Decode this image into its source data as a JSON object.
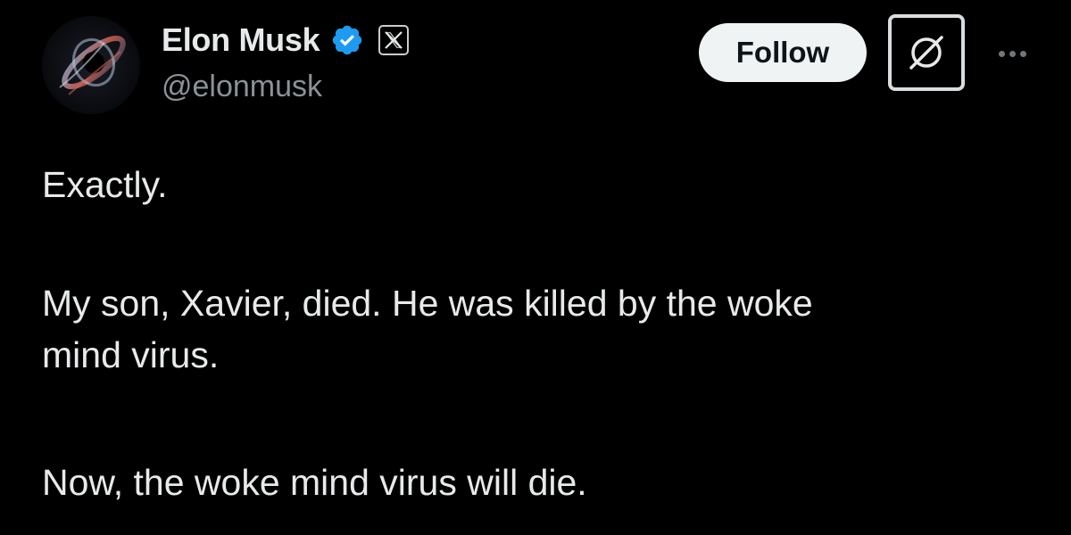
{
  "author": {
    "display_name": "Elon Musk",
    "handle": "@elonmusk",
    "verified_icon": "verified-badge-icon",
    "affiliate_icon": "x-logo-icon",
    "avatar_icon": "black-hole-avatar"
  },
  "actions": {
    "follow_label": "Follow",
    "grok_icon": "grok-icon",
    "more_icon": "more-options-icon"
  },
  "tweet": {
    "paragraphs": [
      "Exactly.",
      "My son, Xavier, died. He was killed by the woke\nmind virus.",
      "Now, the woke mind virus will die."
    ]
  },
  "colors": {
    "background": "#000000",
    "text_primary": "#e7e9ea",
    "text_secondary": "#8b9198",
    "verified_blue": "#1d9bf0",
    "follow_bg": "#eff3f4",
    "follow_text": "#0f1419"
  }
}
